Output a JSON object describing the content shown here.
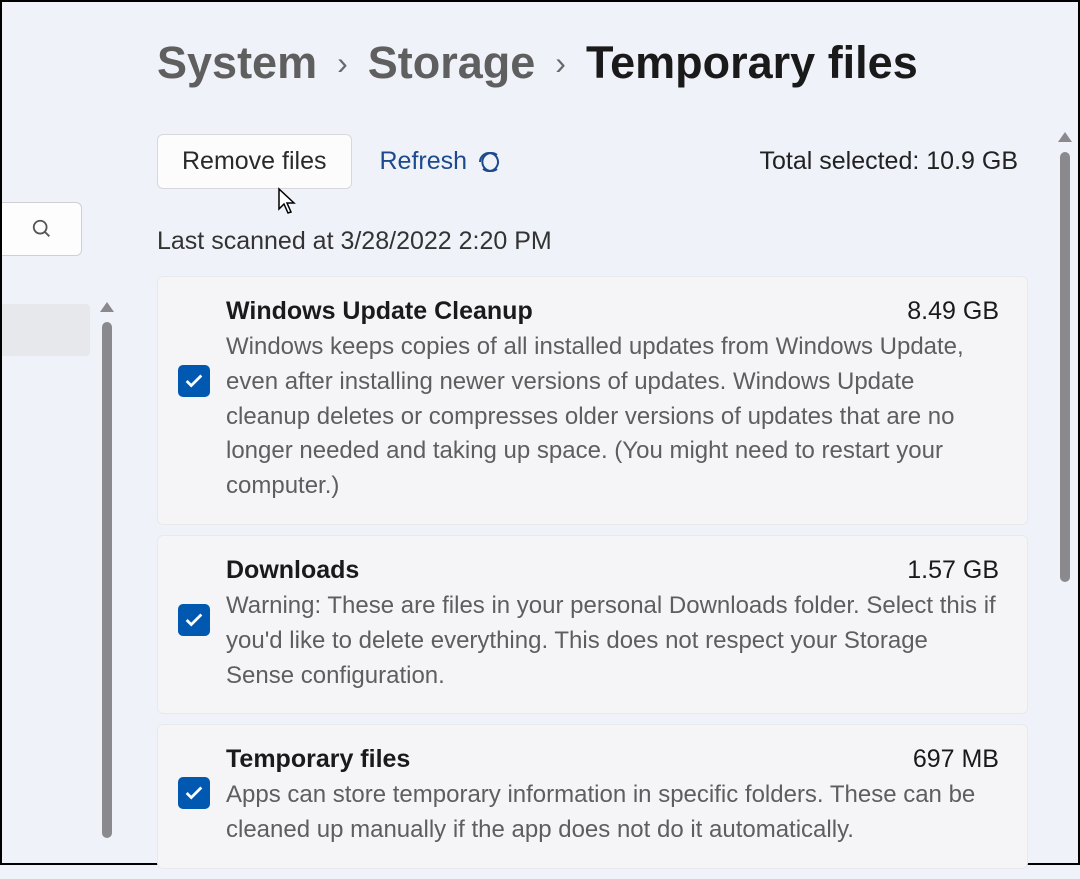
{
  "breadcrumb": {
    "items": [
      {
        "label": "System"
      },
      {
        "label": "Storage"
      },
      {
        "label": "Temporary files",
        "active": true
      }
    ],
    "separator": "›"
  },
  "toolbar": {
    "remove_label": "Remove files",
    "refresh_label": "Refresh",
    "total_selected_label": "Total selected:",
    "total_selected_value": "10.9 GB"
  },
  "last_scanned": "Last scanned at 3/28/2022 2:20 PM",
  "items": [
    {
      "checked": true,
      "title": "Windows Update Cleanup",
      "size": "8.49 GB",
      "description": "Windows keeps copies of all installed updates from Windows Update, even after installing newer versions of updates. Windows Update cleanup deletes or compresses older versions of updates that are no longer needed and taking up space. (You might need to restart your computer.)"
    },
    {
      "checked": true,
      "title": "Downloads",
      "size": "1.57 GB",
      "description": "Warning: These are files in your personal Downloads folder. Select this if you'd like to delete everything. This does not respect your Storage Sense configuration."
    },
    {
      "checked": true,
      "title": "Temporary files",
      "size": "697 MB",
      "description": "Apps can store temporary information in specific folders. These can be cleaned up manually if the app does not do it automatically."
    }
  ]
}
